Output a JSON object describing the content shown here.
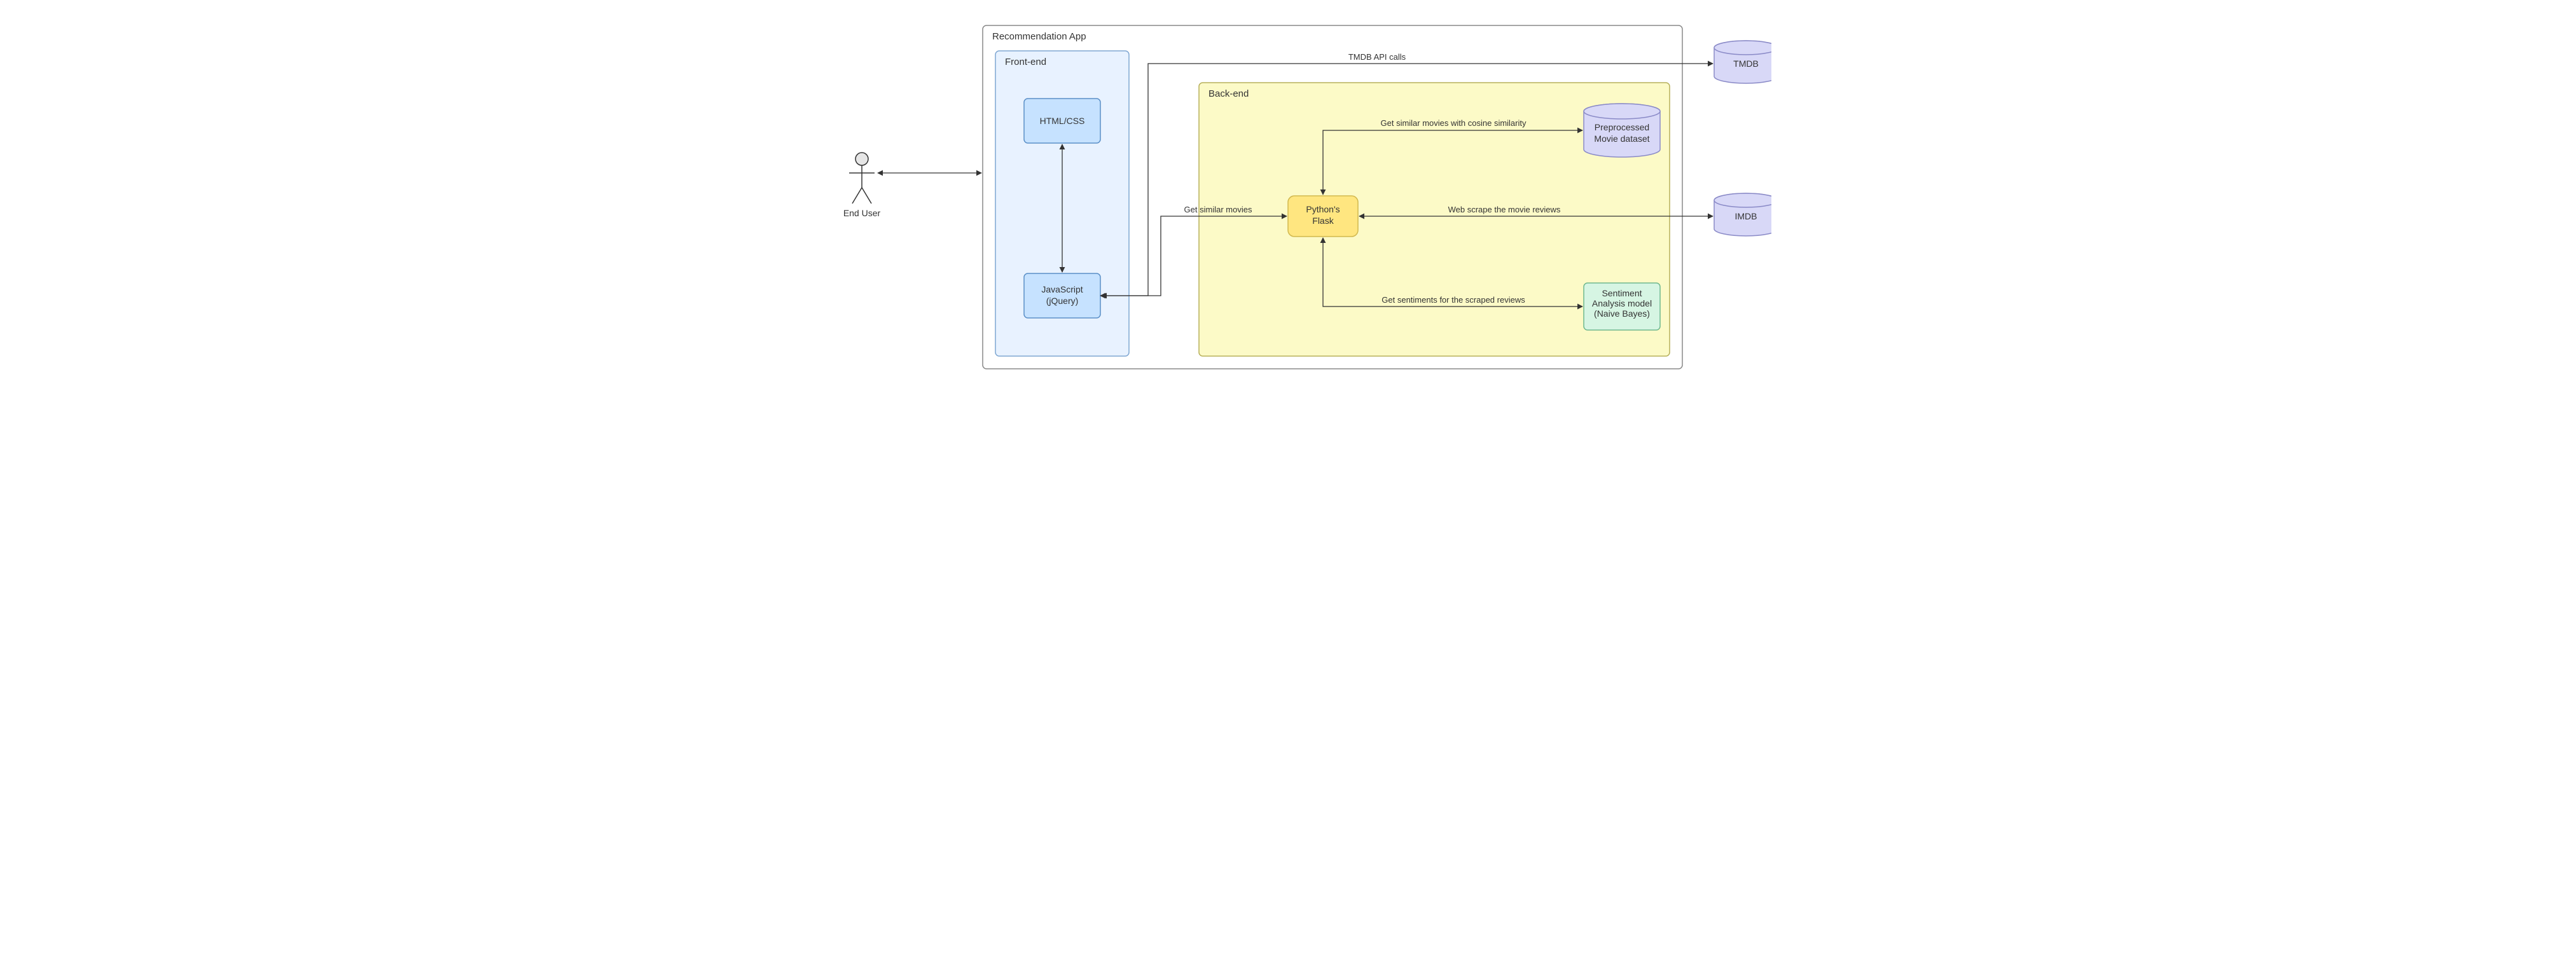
{
  "diagram": {
    "actor": {
      "label": "End User"
    },
    "containers": {
      "app": {
        "label": "Recommendation App"
      },
      "frontend": {
        "label": "Front-end"
      },
      "backend": {
        "label": "Back-end"
      }
    },
    "nodes": {
      "htmlcss": {
        "label": "HTML/CSS"
      },
      "javascript": {
        "line1": "JavaScript",
        "line2": "(jQuery)"
      },
      "flask": {
        "line1": "Python's",
        "line2": "Flask"
      },
      "preprocessed": {
        "line1": "Preprocessed",
        "line2": "Movie dataset"
      },
      "sentiment": {
        "line1": "Sentiment",
        "line2": "Analysis model",
        "line3": "(Naive Bayes)"
      },
      "tmdb": {
        "label": "TMDB"
      },
      "imdb": {
        "label": "IMDB"
      }
    },
    "edges": {
      "tmdb_api": {
        "label": "TMDB API calls"
      },
      "similar_movies": {
        "label": "Get similar movies"
      },
      "cosine": {
        "label": "Get similar movies with cosine similarity"
      },
      "scrape": {
        "label": "Web scrape the movie reviews"
      },
      "sentiments": {
        "label": "Get sentiments for the scraped reviews"
      }
    }
  }
}
